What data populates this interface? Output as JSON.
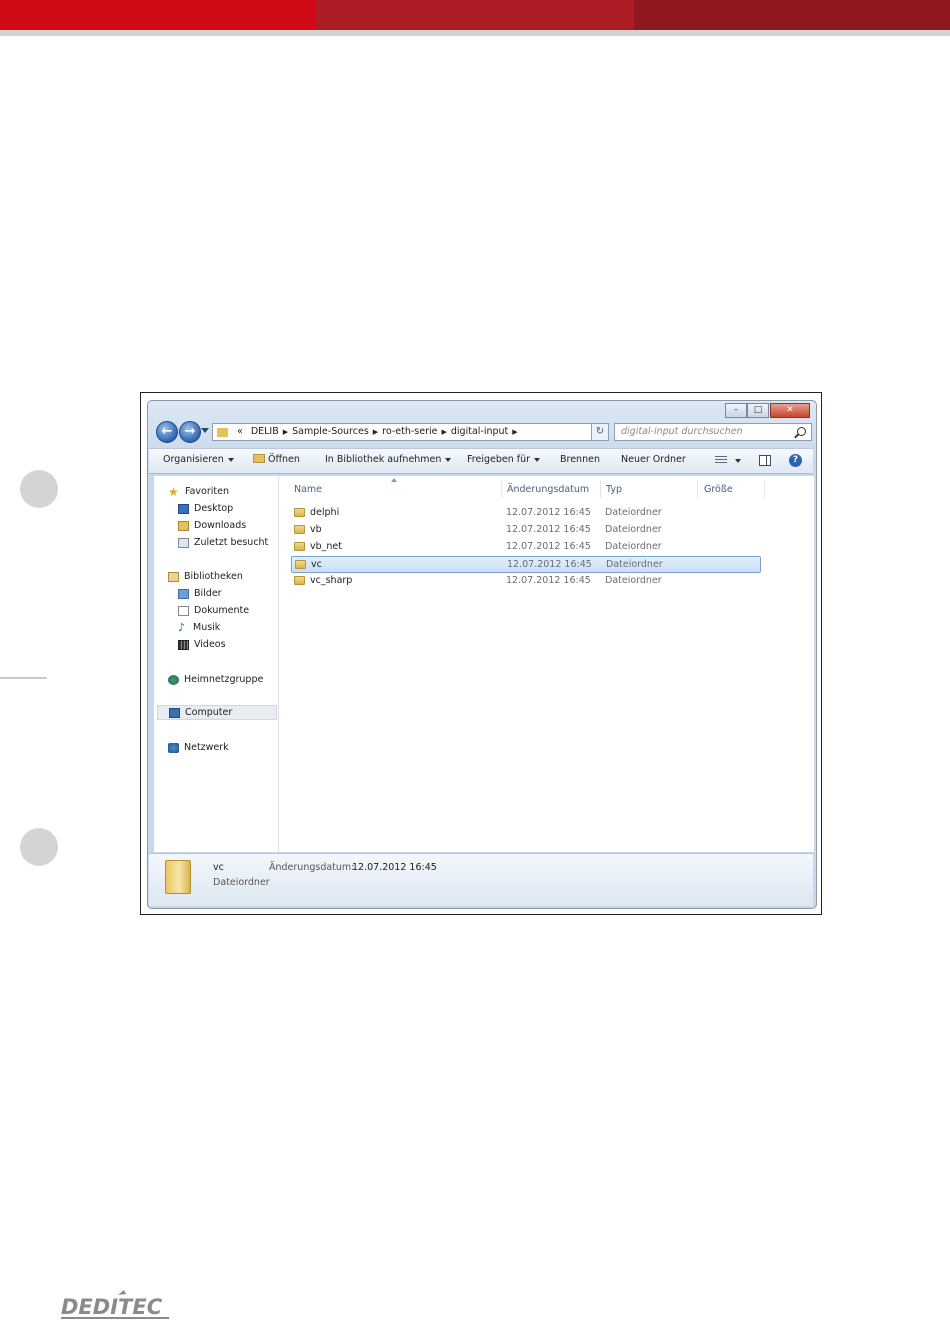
{
  "page": {
    "colors": {
      "bar_left": "#cf0a16",
      "bar_mid": "#ad1c25",
      "bar_right": "#8f1820"
    },
    "footer_logo": {
      "icon": "deditec-logo",
      "text": "DEDITEC"
    }
  },
  "window": {
    "caption_buttons": [
      "minimize",
      "maximize",
      "close"
    ],
    "nav": {
      "back_icon": "back-arrow-icon",
      "forward_icon": "forward-arrow-icon"
    },
    "address": {
      "overflow": "«",
      "crumbs": [
        "DELIB",
        "Sample-Sources",
        "ro-eth-serie",
        "digital-input"
      ]
    },
    "search": {
      "placeholder": "digital-input durchsuchen"
    },
    "toolbar": {
      "organize": "Organisieren",
      "open": "Öffnen",
      "include_library": "In Bibliothek aufnehmen",
      "share": "Freigeben für",
      "burn": "Brennen",
      "new_folder": "Neuer Ordner"
    },
    "sidebar": {
      "favorites": "Favoriten",
      "fav_items": [
        "Desktop",
        "Downloads",
        "Zuletzt besucht"
      ],
      "libraries": "Bibliotheken",
      "lib_items": [
        "Bilder",
        "Dokumente",
        "Musik",
        "Videos"
      ],
      "homegroup": "Heimnetzgruppe",
      "computer": "Computer",
      "network": "Netzwerk"
    },
    "columns": {
      "name": "Name",
      "date": "Änderungsdatum",
      "type": "Typ",
      "size": "Größe"
    },
    "files": [
      {
        "name": "delphi",
        "date": "12.07.2012 16:45",
        "type": "Dateiordner"
      },
      {
        "name": "vb",
        "date": "12.07.2012 16:45",
        "type": "Dateiordner"
      },
      {
        "name": "vb_net",
        "date": "12.07.2012 16:45",
        "type": "Dateiordner"
      },
      {
        "name": "vc",
        "date": "12.07.2012 16:45",
        "type": "Dateiordner",
        "selected": true
      },
      {
        "name": "vc_sharp",
        "date": "12.07.2012 16:45",
        "type": "Dateiordner"
      }
    ],
    "details": {
      "name": "vc",
      "type": "Dateiordner",
      "date_label": "Änderungsdatum:",
      "date_value": "12.07.2012 16:45"
    }
  }
}
